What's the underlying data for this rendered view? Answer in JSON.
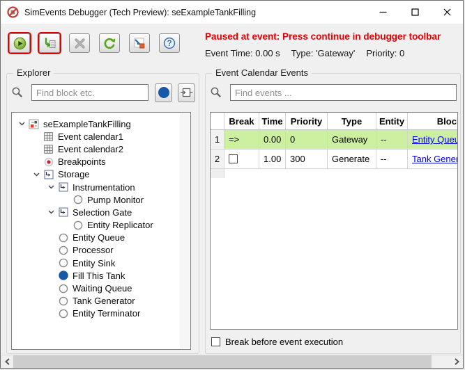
{
  "window": {
    "title": "SimEvents Debugger (Tech Preview): seExampleTankFilling"
  },
  "toolbar": {
    "buttons": [
      {
        "name": "continue",
        "icon": "play-icon",
        "highlighted": true,
        "enabled": true
      },
      {
        "name": "step-to-next-event",
        "icon": "step-icon",
        "highlighted": true,
        "enabled": true
      },
      {
        "name": "stop",
        "icon": "stop-x-icon",
        "highlighted": false,
        "enabled": false
      },
      {
        "name": "refresh",
        "icon": "refresh-icon",
        "highlighted": false,
        "enabled": true
      },
      {
        "name": "show-current-event-block",
        "icon": "goto-block-icon",
        "highlighted": false,
        "enabled": true
      },
      {
        "name": "help",
        "icon": "help-icon",
        "highlighted": false,
        "enabled": true
      }
    ],
    "status": {
      "message": "Paused at event: Press continue in debugger toolbar",
      "event_time": "Event Time: 0.00 s",
      "type": "Type: 'Gateway'",
      "priority": "Priority: 0"
    }
  },
  "explorer": {
    "title": "Explorer",
    "search_placeholder": "Find block etc.",
    "tree": [
      {
        "label": "seExampleTankFilling",
        "level": 0,
        "icon": "model-icon",
        "expanded": true
      },
      {
        "label": "Event calendar1",
        "level": 1,
        "icon": "event-calendar-icon"
      },
      {
        "label": "Event calendar2",
        "level": 1,
        "icon": "event-calendar-icon"
      },
      {
        "label": "Breakpoints",
        "level": 1,
        "icon": "breakpoint-icon"
      },
      {
        "label": "Storage",
        "level": 1,
        "icon": "subsystem-icon",
        "expanded": true
      },
      {
        "label": "Instrumentation",
        "level": 2,
        "icon": "subsystem-icon",
        "expanded": true
      },
      {
        "label": "Pump Monitor",
        "level": 3,
        "icon": "block-circle-icon"
      },
      {
        "label": "Selection Gate",
        "level": 2,
        "icon": "subsystem-icon",
        "expanded": true
      },
      {
        "label": "Entity Replicator",
        "level": 3,
        "icon": "block-circle-icon"
      },
      {
        "label": "Entity Queue",
        "level": 2,
        "icon": "block-circle-icon"
      },
      {
        "label": "Processor",
        "level": 2,
        "icon": "block-circle-icon"
      },
      {
        "label": "Entity Sink",
        "level": 2,
        "icon": "block-circle-icon"
      },
      {
        "label": "Fill This Tank",
        "level": 2,
        "icon": "block-circle-selected-icon",
        "selected": true
      },
      {
        "label": "Waiting Queue",
        "level": 2,
        "icon": "block-circle-icon"
      },
      {
        "label": "Tank Generator",
        "level": 2,
        "icon": "block-circle-icon"
      },
      {
        "label": "Entity Terminator",
        "level": 2,
        "icon": "block-circle-icon"
      }
    ]
  },
  "events": {
    "title": "Event Calendar Events",
    "search_placeholder": "Find events ...",
    "table": {
      "columns": [
        "Break",
        "Time",
        "Priority",
        "Type",
        "Entity",
        "Block"
      ],
      "rows": [
        {
          "num": "1",
          "break_marker": "=>",
          "time": "0.00",
          "priority": "0",
          "type": "Gateway",
          "entity": "--",
          "block": "Entity Queue",
          "highlighted": true
        },
        {
          "num": "2",
          "break_marker": "",
          "time": "1.00",
          "priority": "300",
          "type": "Generate",
          "entity": "--",
          "block": "Tank Generator",
          "highlighted": false
        }
      ]
    },
    "break_checkbox_label": "Break before event execution",
    "break_checkbox_checked": false
  },
  "colors": {
    "highlight_row_green": "#cdf0a0",
    "status_red": "#e50000",
    "link_blue": "#0000dd",
    "selection_blue": "#1858a8",
    "toolbar_highlight_red": "#dd0400"
  }
}
